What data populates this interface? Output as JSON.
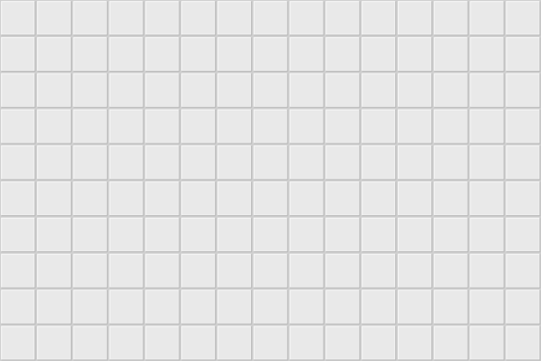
{
  "scene": {
    "subject": "white-square-tile-wall",
    "columns": 15,
    "rows": 10,
    "colors": {
      "grout": "#cfcfcf",
      "tile_face": "#e9e9e9",
      "tile_highlight": "#f6f6f6",
      "tile_shadow": "#bdbdbd"
    }
  }
}
